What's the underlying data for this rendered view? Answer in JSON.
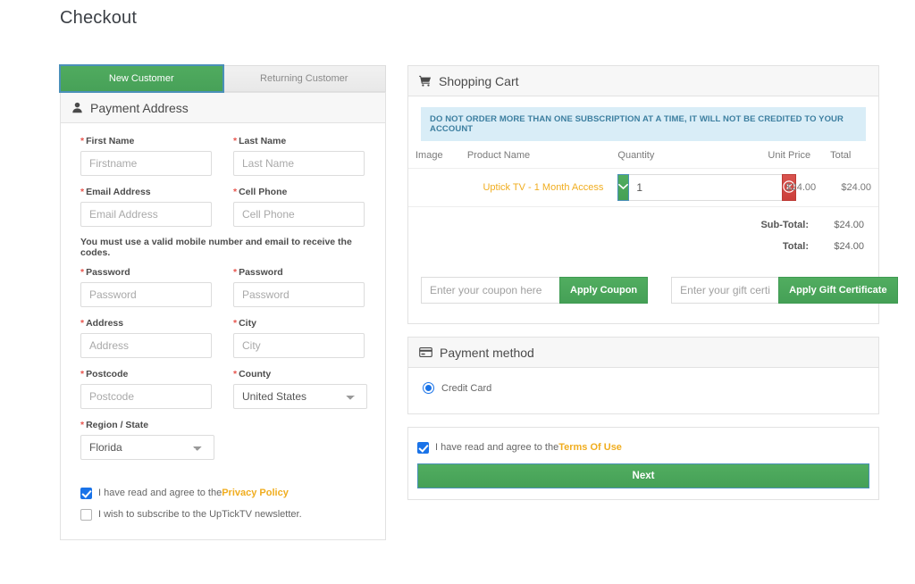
{
  "page": {
    "title": "Checkout"
  },
  "colors": {
    "green": "#4caf63",
    "red": "#d9534f",
    "link_gold": "#f0ad1f",
    "alert_bg": "#d9edf7",
    "alert_text": "#3d7fa0",
    "required_red": "#e8564f",
    "checkbox_blue": "#1a73e8"
  },
  "tabs": [
    {
      "label": "New Customer",
      "active": true
    },
    {
      "label": "Returning Customer",
      "active": false
    }
  ],
  "payment_address": {
    "header": "Payment Address",
    "header_icon": "user-icon",
    "note": "You must use a valid mobile number and email to receive the codes.",
    "fields": [
      {
        "label": "First Name",
        "placeholder": "Firstname",
        "required": true,
        "type": "text"
      },
      {
        "label": "Last Name",
        "placeholder": "Last Name",
        "required": true,
        "type": "text"
      },
      {
        "label": "Email Address",
        "placeholder": "Email Address",
        "required": true,
        "type": "text"
      },
      {
        "label": "Cell Phone",
        "placeholder": "Cell Phone",
        "required": true,
        "type": "text"
      },
      {
        "label": "Password",
        "placeholder": "Password",
        "required": true,
        "type": "text"
      },
      {
        "label": "Password",
        "placeholder": "Password",
        "required": true,
        "type": "text"
      },
      {
        "label": "Address",
        "placeholder": "Address",
        "required": true,
        "type": "text"
      },
      {
        "label": "City",
        "placeholder": "City",
        "required": true,
        "type": "text"
      },
      {
        "label": "Postcode",
        "placeholder": "Postcode",
        "required": true,
        "type": "text"
      },
      {
        "label": "County",
        "value": "United States",
        "required": true,
        "type": "select"
      },
      {
        "label": "Region / State",
        "value": "Florida",
        "required": true,
        "type": "select"
      }
    ],
    "checkboxes": [
      {
        "prefix": "I have read and agree to the ",
        "link": "Privacy Policy",
        "checked": true
      },
      {
        "prefix": "I wish to subscribe to the UpTickTV newsletter.",
        "link": "",
        "checked": false
      }
    ]
  },
  "cart": {
    "header": "Shopping Cart",
    "header_icon": "shopping-cart-icon",
    "alert": "DO NOT ORDER MORE THAN ONE SUBSCRIPTION AT A TIME, IT WILL NOT BE CREDITED TO YOUR ACCOUNT",
    "columns": [
      "Image",
      "Product Name",
      "Quantity",
      "Unit Price",
      "Total"
    ],
    "items": [
      {
        "product_name": "Uptick TV - 1 Month Access",
        "quantity": "1",
        "unit_price": "$24.00",
        "total": "$24.00",
        "update_icon": "chevron-down-icon",
        "remove_icon": "remove-circle-icon"
      }
    ],
    "totals": [
      {
        "label": "Sub-Total:",
        "value": "$24.00"
      },
      {
        "label": "Total:",
        "value": "$24.00"
      }
    ],
    "coupon": {
      "placeholder": "Enter your coupon here",
      "button": "Apply Coupon"
    },
    "gift": {
      "placeholder": "Enter your gift certificate code here",
      "button": "Apply Gift Certificate"
    }
  },
  "payment_method": {
    "header": "Payment method",
    "header_icon": "credit-card-icon",
    "options": [
      {
        "label": "Credit Card",
        "selected": true
      }
    ]
  },
  "footer": {
    "agree_prefix": "I have read and agree to the ",
    "agree_link": "Terms Of Use",
    "agree_checked": true,
    "next_label": "Next"
  }
}
